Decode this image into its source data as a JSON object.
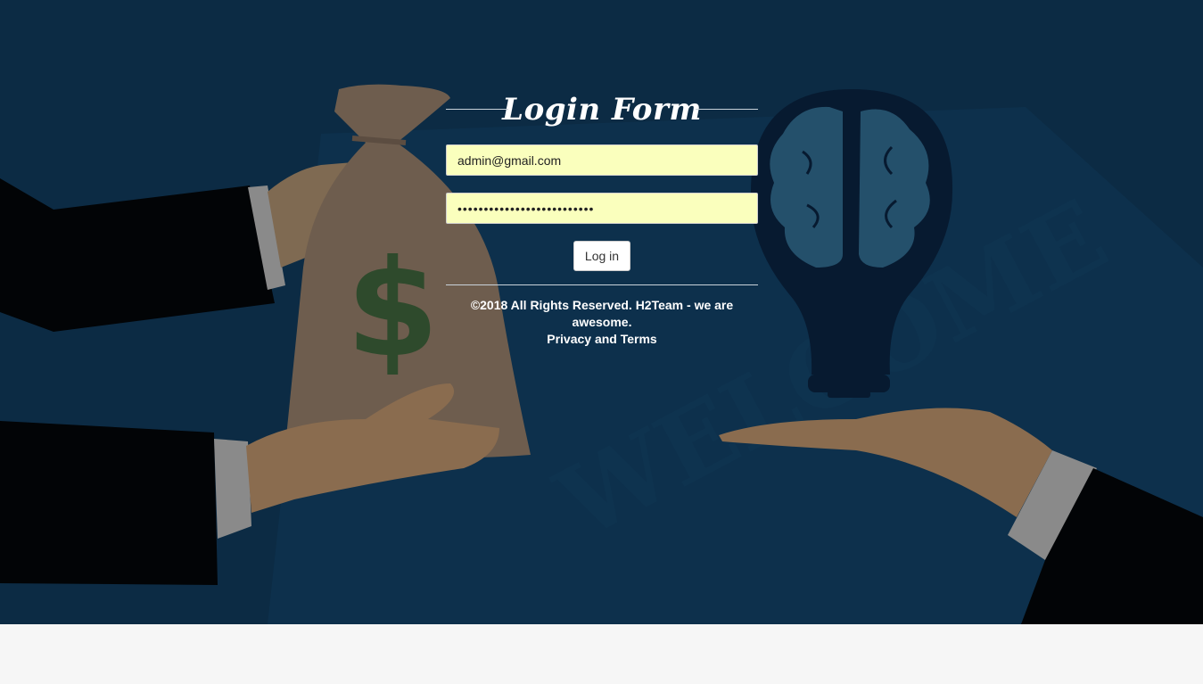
{
  "login_form": {
    "title": "Login Form",
    "email_value": "admin@gmail.com",
    "password_value": "••••••••••••••••••••••••••",
    "login_button_label": "Log in",
    "copyright": "©2018 All Rights Reserved. H2Team - we are awesome.",
    "terms_link": "Privacy and Terms"
  },
  "background": {
    "illustration_text": "WELCOME",
    "icons": [
      "money-bag-icon",
      "dollar-sign-icon",
      "lightbulb-icon",
      "brain-icon"
    ]
  },
  "colors": {
    "background": "#0c2b44",
    "input_fill": "#faffbd",
    "page_footer": "#f6f6f6",
    "text": "#ffffff"
  }
}
